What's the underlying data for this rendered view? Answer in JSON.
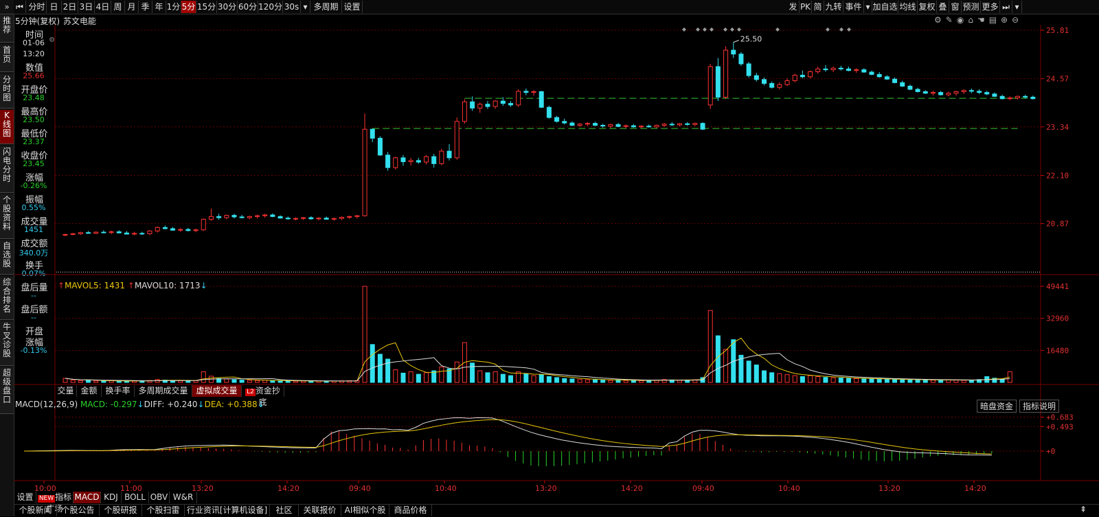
{
  "left_nav": [
    {
      "label": "推荐",
      "active": false
    },
    {
      "label": "首页",
      "active": false
    },
    {
      "label": "分时图",
      "active": false
    },
    {
      "label": "K线图",
      "active": true
    },
    {
      "label": "闪电分时",
      "active": false
    },
    {
      "label": "个股资料",
      "active": false
    },
    {
      "label": "自选股",
      "active": false
    },
    {
      "label": "综合排名",
      "active": false
    },
    {
      "label": "牛叉诊股",
      "active": false
    },
    {
      "label": "超级盘口",
      "active": false
    }
  ],
  "toolbar": {
    "left": [
      "分时",
      "日",
      "2日",
      "3日",
      "4日",
      "周",
      "月",
      "季",
      "年",
      "1分",
      "5分",
      "15分",
      "30分",
      "60分",
      "120分",
      "30s",
      "多周期",
      "设置"
    ],
    "active": "5分",
    "right": [
      "发",
      "PK",
      "简",
      "九转",
      "事件",
      "加自选",
      "均线",
      "复权",
      "叠",
      "窗",
      "预测",
      "更多"
    ]
  },
  "title": {
    "period": "5分钟(复权)",
    "name": "苏文电能"
  },
  "info": [
    {
      "label": "时间",
      "lines": [
        "01-06",
        "13:20"
      ],
      "color": "#ddd"
    },
    {
      "label": "数值",
      "lines": [
        "25.66"
      ],
      "color": "#e03030"
    },
    {
      "label": "开盘价",
      "lines": [
        "23.48"
      ],
      "color": "#2ad12a"
    },
    {
      "label": "最高价",
      "lines": [
        "23.50"
      ],
      "color": "#2ad12a"
    },
    {
      "label": "最低价",
      "lines": [
        "23.37"
      ],
      "color": "#2ad12a"
    },
    {
      "label": "收盘价",
      "lines": [
        "23.45"
      ],
      "color": "#2ad12a"
    },
    {
      "label": "涨幅",
      "lines": [
        "-0.26%"
      ],
      "color": "#2ad12a"
    },
    {
      "label": "振幅",
      "lines": [
        "0.55%"
      ],
      "color": "#33ccee"
    },
    {
      "label": "成交量",
      "lines": [
        "1451"
      ],
      "color": "#33ccee"
    },
    {
      "label": "成交额",
      "lines": [
        "340.0万"
      ],
      "color": "#33ccee"
    },
    {
      "label": "换手",
      "lines": [
        "0.07%"
      ],
      "color": "#33ccee"
    },
    {
      "label": "盘后量",
      "lines": [
        "--"
      ],
      "color": "#33ccee"
    },
    {
      "label": "盘后额",
      "lines": [
        "--"
      ],
      "color": "#33ccee"
    },
    {
      "label": "开盘涨幅",
      "lines": [
        "-0.13%"
      ],
      "color": "#33ccee"
    }
  ],
  "price_axis": [
    "25.81",
    "24.57",
    "23.34",
    "22.10",
    "20.87"
  ],
  "peak_label": "25.50",
  "volume": {
    "mavol5_label": "MAVOL5:",
    "mavol5": "1431",
    "mavol10_label": "MAVOL10:",
    "mavol10": "1713",
    "axis": [
      "49441",
      "32960",
      "16480"
    ]
  },
  "vol_tabs": [
    "交量",
    "金额",
    "换手率",
    "多周期成交量",
    "虚拟成交量",
    "资金抄底"
  ],
  "vol_tab_active": "虚拟成交量",
  "macd": {
    "title": "MACD(12,26,9)",
    "macd_label": "MACD:",
    "macd": "-0.297",
    "diff_label": "DIFF:",
    "diff": "+0.240",
    "dea_label": "DEA:",
    "dea": "+0.388",
    "axis": [
      "+0.683",
      "+0.493",
      "+0"
    ],
    "buttons": [
      "暗盘资金",
      "指标说明"
    ]
  },
  "time_axis": [
    "10:00",
    "11:00",
    "13:20",
    "14:20",
    "09:40",
    "10:40",
    "13:20",
    "14:20",
    "09:40",
    "10:40",
    "13:20",
    "14:20"
  ],
  "indicator_tabs": [
    "设置",
    "指标广场",
    "MACD",
    "KDJ",
    "BOLL",
    "OBV",
    "W&R"
  ],
  "indicator_active": "MACD",
  "bottom_tabs": [
    "个股新闻",
    "个股公告",
    "个股研报",
    "个股扫雷",
    "行业资讯[计算机设备]",
    "社区",
    "关联报价",
    "AI相似个股",
    "商品价格"
  ],
  "chart_data": {
    "type": "candlestick",
    "price_range": [
      19.6,
      25.95
    ],
    "candles": [
      [
        20.58,
        20.61,
        20.55,
        20.59
      ],
      [
        20.59,
        20.63,
        20.57,
        20.61
      ],
      [
        20.61,
        20.66,
        20.58,
        20.64
      ],
      [
        20.64,
        20.68,
        20.61,
        20.62
      ],
      [
        20.62,
        20.67,
        20.6,
        20.65
      ],
      [
        20.65,
        20.7,
        20.62,
        20.64
      ],
      [
        20.64,
        20.69,
        20.6,
        20.66
      ],
      [
        20.66,
        20.7,
        20.62,
        20.63
      ],
      [
        20.63,
        20.68,
        20.59,
        20.6
      ],
      [
        20.6,
        20.66,
        20.57,
        20.62
      ],
      [
        20.62,
        20.66,
        20.58,
        20.61
      ],
      [
        20.61,
        20.7,
        20.58,
        20.68
      ],
      [
        20.68,
        20.8,
        20.64,
        20.77
      ],
      [
        20.77,
        20.82,
        20.72,
        20.74
      ],
      [
        20.74,
        20.78,
        20.69,
        20.7
      ],
      [
        20.7,
        20.75,
        20.66,
        20.72
      ],
      [
        20.72,
        20.76,
        20.67,
        20.69
      ],
      [
        20.69,
        20.74,
        20.65,
        20.71
      ],
      [
        20.71,
        21.0,
        20.68,
        20.98
      ],
      [
        20.98,
        21.25,
        20.94,
        21.05
      ],
      [
        21.05,
        21.12,
        20.97,
        21.02
      ],
      [
        21.02,
        21.1,
        20.98,
        21.08
      ],
      [
        21.08,
        21.12,
        21.0,
        21.04
      ],
      [
        21.04,
        21.09,
        21.0,
        21.02
      ],
      [
        21.02,
        21.07,
        20.98,
        21.05
      ],
      [
        21.05,
        21.1,
        21.0,
        21.07
      ],
      [
        21.07,
        21.12,
        21.02,
        21.09
      ],
      [
        21.09,
        21.13,
        21.03,
        21.05
      ],
      [
        21.05,
        21.08,
        21.0,
        21.01
      ],
      [
        21.01,
        21.05,
        20.97,
        20.99
      ],
      [
        20.99,
        21.03,
        20.95,
        21.0
      ],
      [
        21.0,
        21.04,
        20.96,
        21.02
      ],
      [
        21.02,
        21.06,
        20.97,
        20.99
      ],
      [
        20.99,
        21.03,
        20.95,
        21.01
      ],
      [
        21.01,
        21.05,
        20.97,
        20.98
      ],
      [
        20.98,
        21.02,
        20.94,
        21.0
      ],
      [
        21.0,
        21.05,
        20.96,
        21.03
      ],
      [
        21.03,
        21.07,
        20.99,
        21.05
      ],
      [
        21.05,
        21.09,
        21.0,
        21.07
      ],
      [
        21.07,
        23.68,
        21.05,
        23.28
      ],
      [
        23.28,
        23.3,
        22.95,
        23.05
      ],
      [
        23.05,
        23.1,
        22.6,
        22.62
      ],
      [
        22.62,
        22.7,
        22.22,
        22.3
      ],
      [
        22.3,
        22.58,
        22.25,
        22.55
      ],
      [
        22.55,
        22.62,
        22.35,
        22.45
      ],
      [
        22.45,
        22.55,
        22.35,
        22.48
      ],
      [
        22.48,
        22.55,
        22.4,
        22.44
      ],
      [
        22.44,
        22.62,
        22.38,
        22.58
      ],
      [
        22.58,
        22.65,
        22.3,
        22.4
      ],
      [
        22.4,
        22.78,
        22.36,
        22.72
      ],
      [
        22.72,
        22.9,
        22.48,
        22.55
      ],
      [
        22.55,
        23.58,
        22.5,
        23.48
      ],
      [
        23.48,
        24.05,
        23.42,
        23.98
      ],
      [
        23.98,
        24.12,
        23.75,
        23.82
      ],
      [
        23.82,
        23.96,
        23.7,
        23.92
      ],
      [
        23.92,
        24.0,
        23.8,
        23.86
      ],
      [
        23.86,
        24.02,
        23.8,
        24.0
      ],
      [
        24.0,
        24.1,
        23.88,
        23.94
      ],
      [
        23.94,
        24.0,
        23.85,
        23.9
      ],
      [
        23.9,
        24.3,
        23.85,
        24.25
      ],
      [
        24.25,
        24.32,
        24.15,
        24.22
      ],
      [
        24.22,
        24.28,
        24.14,
        24.24
      ],
      [
        24.24,
        24.26,
        23.82,
        23.84
      ],
      [
        23.84,
        23.88,
        23.55,
        23.58
      ],
      [
        23.58,
        23.62,
        23.45,
        23.48
      ],
      [
        23.48,
        23.55,
        23.4,
        23.44
      ],
      [
        23.44,
        23.48,
        23.36,
        23.38
      ],
      [
        23.38,
        23.44,
        23.34,
        23.41
      ],
      [
        23.41,
        23.46,
        23.36,
        23.43
      ],
      [
        23.43,
        23.47,
        23.36,
        23.38
      ],
      [
        23.38,
        23.42,
        23.32,
        23.36
      ],
      [
        23.36,
        23.42,
        23.31,
        23.4
      ],
      [
        23.4,
        23.44,
        23.33,
        23.35
      ],
      [
        23.35,
        23.4,
        23.31,
        23.37
      ],
      [
        23.37,
        23.41,
        23.32,
        23.34
      ],
      [
        23.34,
        23.38,
        23.3,
        23.36
      ],
      [
        23.36,
        23.4,
        23.32,
        23.34
      ],
      [
        23.34,
        23.4,
        23.31,
        23.38
      ],
      [
        23.38,
        23.44,
        23.34,
        23.41
      ],
      [
        23.41,
        23.46,
        23.36,
        23.39
      ],
      [
        23.39,
        23.44,
        23.35,
        23.42
      ],
      [
        23.42,
        23.46,
        23.37,
        23.4
      ],
      [
        23.4,
        23.45,
        23.36,
        23.43
      ],
      [
        23.43,
        23.46,
        23.26,
        23.28
      ],
      [
        23.9,
        24.95,
        23.8,
        24.88
      ],
      [
        24.88,
        25.1,
        24.0,
        24.1
      ],
      [
        24.1,
        25.4,
        24.05,
        25.3
      ],
      [
        25.3,
        25.5,
        25.1,
        25.2
      ],
      [
        25.2,
        25.25,
        24.9,
        24.95
      ],
      [
        24.95,
        25.0,
        24.6,
        24.65
      ],
      [
        24.65,
        24.72,
        24.5,
        24.55
      ],
      [
        24.55,
        24.6,
        24.4,
        24.45
      ],
      [
        24.45,
        24.5,
        24.32,
        24.35
      ],
      [
        24.35,
        24.48,
        24.3,
        24.42
      ],
      [
        24.42,
        24.58,
        24.38,
        24.52
      ],
      [
        24.52,
        24.7,
        24.48,
        24.66
      ],
      [
        24.66,
        24.78,
        24.58,
        24.62
      ],
      [
        24.62,
        24.78,
        24.58,
        24.75
      ],
      [
        24.75,
        24.88,
        24.7,
        24.82
      ],
      [
        24.82,
        24.92,
        24.75,
        24.8
      ],
      [
        24.8,
        24.88,
        24.74,
        24.84
      ],
      [
        24.84,
        24.9,
        24.78,
        24.82
      ],
      [
        24.82,
        24.88,
        24.76,
        24.78
      ],
      [
        24.78,
        24.84,
        24.72,
        24.8
      ],
      [
        24.8,
        24.84,
        24.72,
        24.74
      ],
      [
        24.74,
        24.78,
        24.66,
        24.68
      ],
      [
        24.68,
        24.74,
        24.6,
        24.62
      ],
      [
        24.62,
        24.66,
        24.54,
        24.56
      ],
      [
        24.56,
        24.6,
        24.45,
        24.47
      ],
      [
        24.47,
        24.52,
        24.36,
        24.38
      ],
      [
        24.38,
        24.42,
        24.28,
        24.3
      ],
      [
        24.3,
        24.34,
        24.22,
        24.24
      ],
      [
        24.24,
        24.28,
        24.18,
        24.2
      ],
      [
        24.2,
        24.26,
        24.14,
        24.22
      ],
      [
        24.22,
        24.26,
        24.14,
        24.16
      ],
      [
        24.16,
        24.24,
        24.12,
        24.2
      ],
      [
        24.2,
        24.26,
        24.14,
        24.24
      ],
      [
        24.24,
        24.3,
        24.18,
        24.27
      ],
      [
        24.27,
        24.32,
        24.2,
        24.25
      ],
      [
        24.25,
        24.3,
        24.18,
        24.22
      ],
      [
        24.22,
        24.26,
        24.15,
        24.18
      ],
      [
        24.18,
        24.22,
        24.1,
        24.12
      ],
      [
        24.12,
        24.16,
        24.04,
        24.06
      ],
      [
        24.06,
        24.12,
        24.02,
        24.08
      ],
      [
        24.08,
        24.14,
        24.04,
        24.12
      ],
      [
        24.12,
        24.16,
        24.06,
        24.1
      ],
      [
        24.1,
        24.14,
        24.04,
        24.06
      ]
    ],
    "volumes": [
      2100,
      1200,
      900,
      1100,
      800,
      700,
      900,
      600,
      700,
      800,
      900,
      1000,
      1500,
      1200,
      1000,
      900,
      800,
      900,
      5500,
      3200,
      2000,
      1800,
      1400,
      1200,
      1100,
      1000,
      1200,
      900,
      800,
      700,
      700,
      800,
      700,
      700,
      600,
      700,
      800,
      900,
      1000,
      49441,
      19500,
      14500,
      12000,
      6500,
      4800,
      5500,
      4200,
      5000,
      6000,
      8000,
      7000,
      10500,
      20500,
      10000,
      6000,
      5000,
      5500,
      4200,
      3500,
      5500,
      4500,
      3500,
      4000,
      3000,
      2500,
      2000,
      1800,
      1500,
      1400,
      1600,
      1200,
      1100,
      1300,
      1000,
      1100,
      900,
      1000,
      1200,
      1500,
      1300,
      1100,
      1200,
      1400,
      2500,
      37000,
      24000,
      17000,
      22000,
      14000,
      11000,
      9000,
      6000,
      5000,
      4500,
      4000,
      3500,
      3000,
      3500,
      3000,
      2600,
      2400,
      2300,
      2100,
      2000,
      1900,
      1800,
      1700,
      1600,
      1500,
      1500,
      1400,
      1300,
      1300,
      1200,
      1300,
      1400,
      1200,
      1100,
      1000,
      1500,
      3000,
      2200,
      1800,
      5500
    ],
    "gap_lines": [
      {
        "price": 23.3,
        "from": 40,
        "to": 124
      },
      {
        "price": 24.07,
        "from": 52,
        "to": 126
      }
    ],
    "avg_line": 19.63
  }
}
